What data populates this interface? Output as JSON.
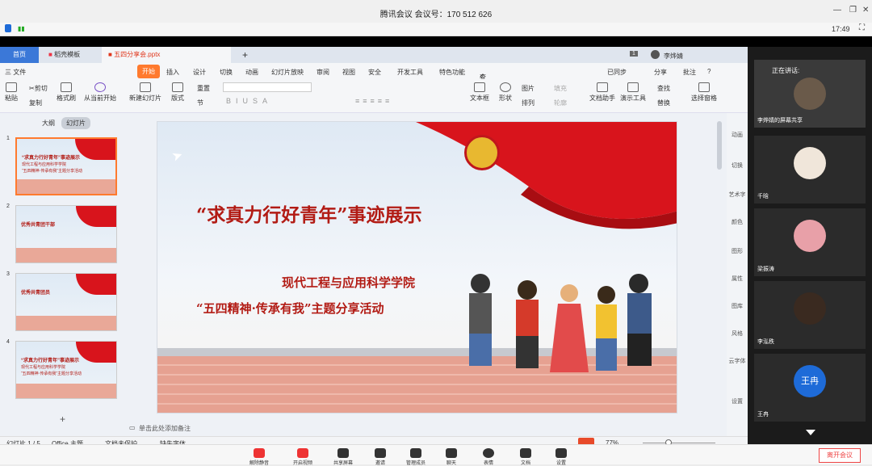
{
  "window": {
    "title": "腾讯会议 会议号：170 512 626",
    "clock": "17:49"
  },
  "tabs": [
    {
      "label": "首页"
    },
    {
      "label": "稻壳模板"
    },
    {
      "label": "五四分享会.pptx"
    },
    {
      "label": "+"
    }
  ],
  "user": {
    "page_badge": "1",
    "name": "李烨婧"
  },
  "menu": [
    "开始",
    "插入",
    "设计",
    "切换",
    "动画",
    "幻灯片放映",
    "审阅",
    "视图",
    "安全",
    "开发工具",
    "特色功能",
    "查找"
  ],
  "menu_left": "三 文件",
  "menu_right": [
    "已同步",
    "分享",
    "批注",
    "?"
  ],
  "ribbon": {
    "paste": "粘贴",
    "cut": "剪切",
    "copy": "复制",
    "format_painter": "格式刷",
    "from_current": "从当前开始",
    "new_slide": "新建幻灯片",
    "layout": "版式",
    "section": "节",
    "reset": "重置",
    "textbox": "文本框",
    "shape": "形状",
    "arrange": "排列",
    "image": "图片",
    "fill": "填充",
    "outline": "轮廓",
    "doc_assistant": "文档助手",
    "present_tools": "演示工具",
    "find": "查找",
    "replace": "替换",
    "select_pane": "选择窗格"
  },
  "left": {
    "outline_tab": "大纲",
    "slides_tab": "幻灯片",
    "numbers": [
      "1",
      "2",
      "3",
      "4"
    ],
    "add": "+"
  },
  "slide": {
    "title": "“求真力行好青年”事迹展示",
    "subtitle1": "现代工程与应用科学学院",
    "subtitle2": "“五四精神·传承有我”主题分享活动"
  },
  "thumbs": [
    {
      "t1": "“求真力行好青年”事迹展示",
      "t2": "现代工程与应用科学学院",
      "t3": "“五四精神·传承有我”主题分享活动"
    },
    {
      "t1": "优秀共青团干部",
      "t2": "",
      "t3": ""
    },
    {
      "t1": "优秀共青团员",
      "t2": "",
      "t3": ""
    },
    {
      "t1": "“求真力行好青年”事迹展示",
      "t2": "现代工程与应用科学学院",
      "t3": "“五四精神·传承有我”主题分享活动"
    }
  ],
  "right_tools": [
    "动画",
    "切换",
    "艺术字",
    "颜色",
    "图形",
    "属性",
    "图库",
    "风格",
    "云字体",
    "设置"
  ],
  "notes_hint": "单击此处添加备注",
  "status": {
    "slide_num": "幻灯片 1 / 5",
    "theme": "Office 主题",
    "protect": "文档未保护",
    "font_missing": "缺失字体",
    "zoom": "77%"
  },
  "gallery": {
    "speaking_label": "正在讲话:",
    "tiles": [
      {
        "name": "李烨婧的屏幕共享"
      },
      {
        "name": "千晗"
      },
      {
        "name": "梁振涛"
      },
      {
        "name": "李泓秩"
      },
      {
        "name": "王冉",
        "initials": "王冉"
      }
    ]
  },
  "dock": [
    "解除静音",
    "开启视频",
    "共享屏幕",
    "邀请",
    "管理成员",
    "聊天",
    "表情",
    "文档",
    "设置"
  ],
  "dock_leave": "离开会议",
  "colors": {
    "accent": "#e0371c",
    "title_red": "#b21b14",
    "tab_active": "#ff7a2e",
    "blue": "#1e6bd8"
  }
}
